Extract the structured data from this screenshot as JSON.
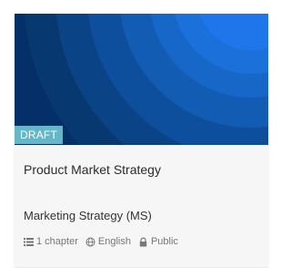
{
  "course_card": {
    "status_badge": "DRAFT",
    "title": "Product Market Strategy",
    "subtitle": "Marketing Strategy (MS)",
    "meta": {
      "chapters": "1 chapter",
      "language": "English",
      "visibility": "Public"
    },
    "icons": {
      "chapters_icon": "list-icon",
      "language_icon": "globe-icon",
      "visibility_icon": "lock-icon"
    }
  },
  "colors": {
    "badge_background": "#65b6c8",
    "cover_dark": "#052f68",
    "cover_light": "#1f76ea",
    "card_background": "#f6f6f6",
    "title_text": "#2b2b2b",
    "meta_text": "#777777"
  }
}
